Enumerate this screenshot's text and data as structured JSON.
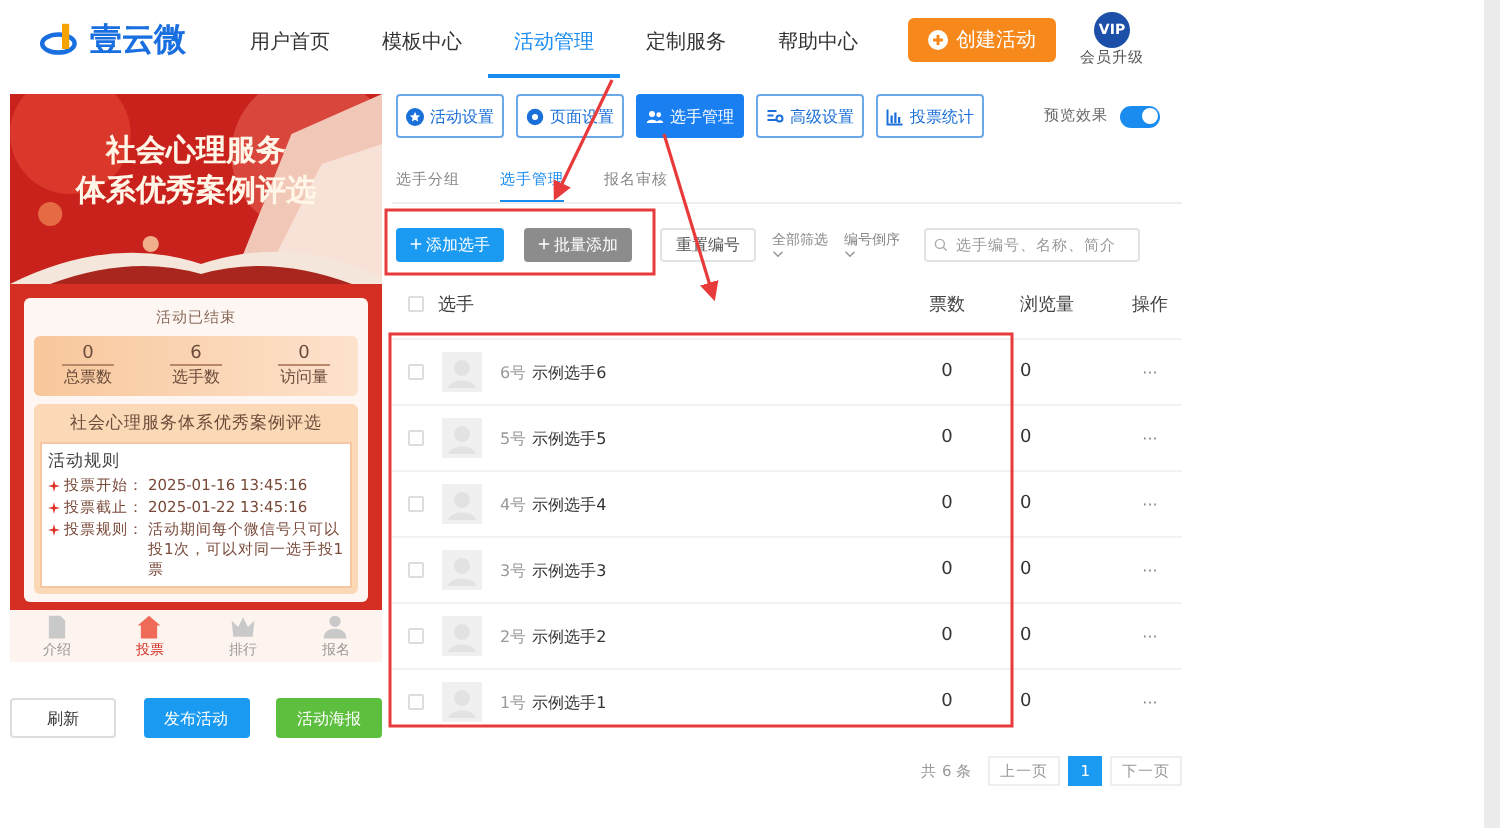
{
  "header": {
    "logo_text": "壹云微",
    "nav": [
      {
        "label": "用户首页",
        "selected": false
      },
      {
        "label": "模板中心",
        "selected": false
      },
      {
        "label": "活动管理",
        "selected": true
      },
      {
        "label": "定制服务",
        "selected": false
      },
      {
        "label": "帮助中心",
        "selected": false
      }
    ],
    "create_button": "创建活动",
    "vip_badge": "VIP",
    "vip_label": "会员升级"
  },
  "preview": {
    "banner_title": [
      "社会心理服务",
      "体系优秀案例评选"
    ],
    "status": "活动已结束",
    "stats": [
      {
        "value": "0",
        "label": "总票数"
      },
      {
        "value": "6",
        "label": "选手数"
      },
      {
        "value": "0",
        "label": "访问量"
      }
    ],
    "card_title": "社会心理服务体系优秀案例评选",
    "rules_heading": "活动规则",
    "rules": [
      {
        "label": "投票开始：",
        "value": "2025-01-16 13:45:16"
      },
      {
        "label": "投票截止：",
        "value": "2025-01-22 13:45:16"
      },
      {
        "label": "投票规则：",
        "value": "活动期间每个微信号只可以投1次，可以对同一选手投1票"
      }
    ],
    "nav": [
      {
        "label": "介绍",
        "kind": "doc",
        "selected": false
      },
      {
        "label": "投票",
        "kind": "home",
        "selected": true
      },
      {
        "label": "排行",
        "kind": "crown",
        "selected": false
      },
      {
        "label": "报名",
        "kind": "person",
        "selected": false
      }
    ]
  },
  "preview_buttons": [
    {
      "label": "刷新",
      "kind": "default"
    },
    {
      "label": "发布活动",
      "kind": "primary"
    },
    {
      "label": "活动海报",
      "kind": "success"
    }
  ],
  "settings_tabs": [
    {
      "label": "活动设置",
      "kind": "star",
      "selected": false
    },
    {
      "label": "页面设置",
      "kind": "gear",
      "selected": false
    },
    {
      "label": "选手管理",
      "kind": "people",
      "selected": true
    },
    {
      "label": "高级设置",
      "kind": "list",
      "selected": false
    },
    {
      "label": "投票统计",
      "kind": "chart",
      "selected": false
    }
  ],
  "preview_toggle": {
    "label": "预览效果",
    "on": true
  },
  "sub_tabs": [
    {
      "label": "选手分组",
      "selected": false
    },
    {
      "label": "选手管理",
      "selected": true
    },
    {
      "label": "报名审核",
      "selected": false
    }
  ],
  "actions": {
    "add": "添加选手",
    "batch": "批量添加",
    "reset": "重置编号",
    "filter": "全部筛选",
    "sort": "编号倒序",
    "search_placeholder": "选手编号、名称、简介"
  },
  "table": {
    "select_all_checked": false,
    "columns": [
      "选手",
      "票数",
      "浏览量",
      "操作"
    ],
    "rows": [
      {
        "number": "6号",
        "name": "示例选手6",
        "votes": "0",
        "views": "0",
        "action": "···",
        "checked": false
      },
      {
        "number": "5号",
        "name": "示例选手5",
        "votes": "0",
        "views": "0",
        "action": "···",
        "checked": false
      },
      {
        "number": "4号",
        "name": "示例选手4",
        "votes": "0",
        "views": "0",
        "action": "···",
        "checked": false
      },
      {
        "number": "3号",
        "name": "示例选手3",
        "votes": "0",
        "views": "0",
        "action": "···",
        "checked": false
      },
      {
        "number": "2号",
        "name": "示例选手2",
        "votes": "0",
        "views": "0",
        "action": "···",
        "checked": false
      },
      {
        "number": "1号",
        "name": "示例选手1",
        "votes": "0",
        "views": "0",
        "action": "···",
        "checked": false
      }
    ]
  },
  "pagination": {
    "total": "共 6 条",
    "prev": "上一页",
    "pages": [
      {
        "label": "1",
        "selected": true
      }
    ],
    "next": "下一页"
  }
}
